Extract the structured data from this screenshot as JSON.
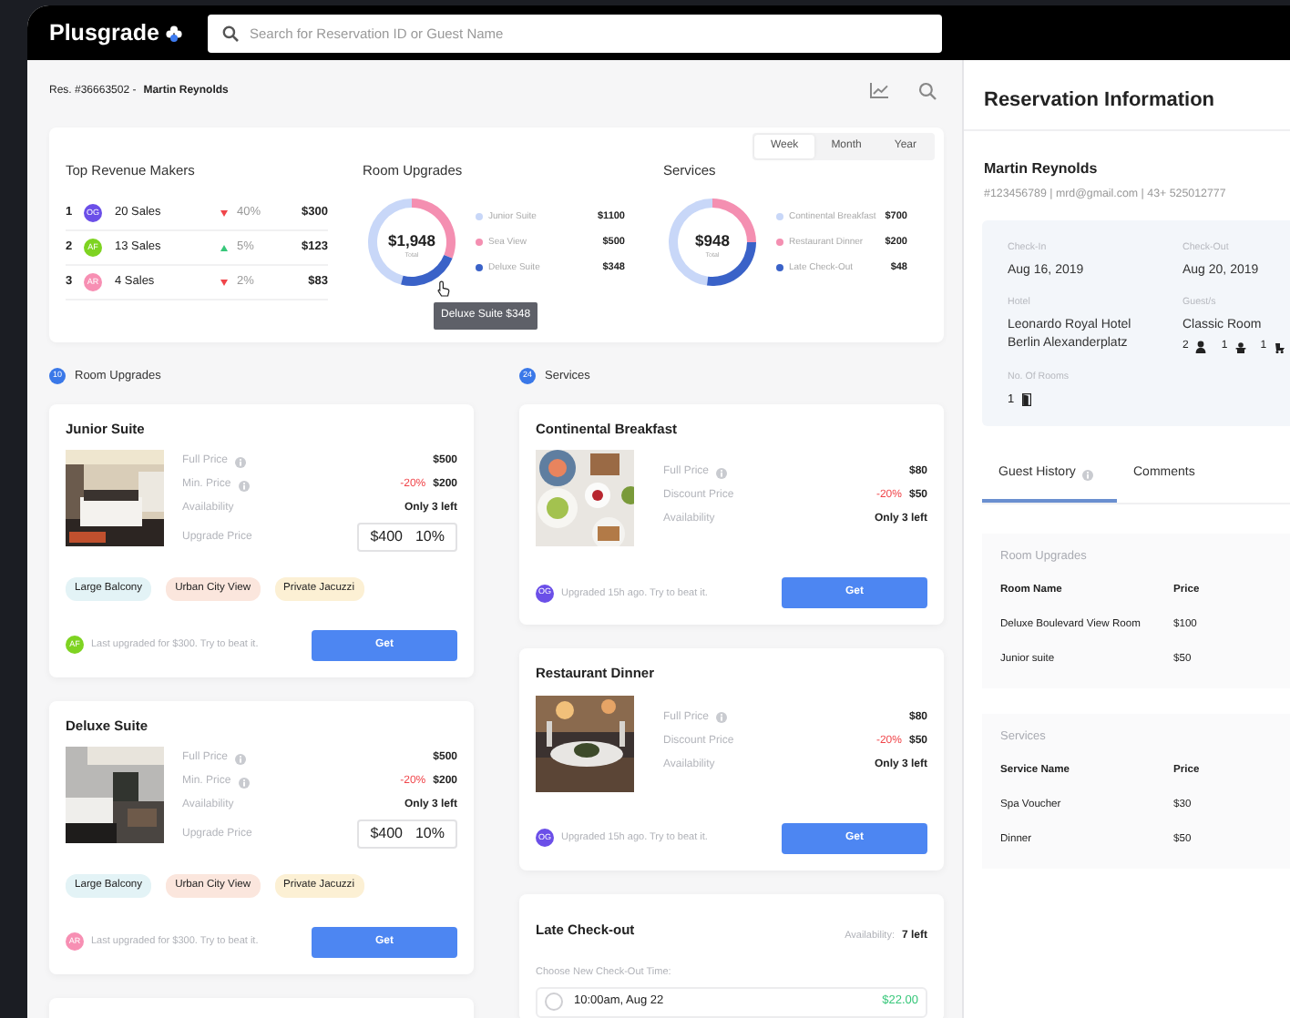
{
  "topbar": {
    "logo": "Plusgrade",
    "search_placeholder": "Search for Reservation ID or Guest Name"
  },
  "breadcrumb": {
    "reservation": "Res. #36663502 -",
    "guest": "Martin Reynolds"
  },
  "period_tabs": [
    {
      "label": "Week",
      "selected": true
    },
    {
      "label": "Month",
      "selected": false
    },
    {
      "label": "Year",
      "selected": false
    }
  ],
  "top_revenue": {
    "title": "Top Revenue Makers",
    "rows": [
      {
        "rank": "1",
        "initials": "OG",
        "color": "#6b4fe8",
        "sales": "20 Sales",
        "rising": false,
        "change": "40%",
        "amount": "$300"
      },
      {
        "rank": "2",
        "initials": "AF",
        "color": "#7ed321",
        "sales": "13 Sales",
        "rising": true,
        "change": "5%",
        "amount": "$123"
      },
      {
        "rank": "3",
        "initials": "AR",
        "color": "#f78fb3",
        "sales": "4 Sales",
        "rising": false,
        "change": "2%",
        "amount": "$83"
      }
    ]
  },
  "summaries": [
    {
      "title": "Room Upgrades",
      "total": "$1,948",
      "total_label": "Total",
      "tooltip": "Deluxe Suite $348",
      "legend": [
        {
          "value": "$1100",
          "color": "#c8d7f8"
        },
        {
          "value": "$500",
          "color": "#f48fb1"
        },
        {
          "value": "$348",
          "color": "#3a62c8"
        }
      ],
      "chart_data": {
        "type": "donut",
        "categories": [
          "Junior Suite",
          "Sea View",
          "Deluxe Suite"
        ],
        "values": [
          46,
          31,
          23
        ]
      }
    },
    {
      "title": "Services",
      "total": "$948",
      "total_label": "Total",
      "legend": [
        {
          "value": "$700",
          "color": "#c8d7f8"
        },
        {
          "value": "$200",
          "color": "#f48fb1"
        },
        {
          "value": "$48",
          "color": "#3a62c8"
        }
      ],
      "chart_data": {
        "type": "donut",
        "categories": [
          "Continental Breakfast",
          "Restaurant Dinner",
          "Late Check-Out"
        ],
        "values": [
          48,
          25,
          27
        ]
      }
    }
  ],
  "room_upgrades": {
    "count": "10",
    "title": "Room Upgrades",
    "cards": [
      {
        "title": "Junior Suite",
        "rows": [
          {
            "label": "Full Price",
            "info": true,
            "value": "$500"
          },
          {
            "label": "Min. Price",
            "info": true,
            "discount": "-20%",
            "value": "$200"
          },
          {
            "label": "Availability",
            "value": "Only 3 left"
          },
          {
            "label": "Upgrade Price",
            "kind": "field",
            "value": "$400",
            "percent": "10%"
          }
        ],
        "tags": [
          {
            "label": "Large Balcony",
            "color": "#e3f3f6"
          },
          {
            "label": "Urban City View",
            "color": "#fbe6dd"
          },
          {
            "label": "Private Jacuzzi",
            "color": "#fcf0d4"
          }
        ],
        "footer": {
          "initials": "AF",
          "color": "#7ed321",
          "note": "Last upgraded for $300. Try to beat it.",
          "button": "Get"
        }
      },
      {
        "title": "Deluxe Suite",
        "rows": [
          {
            "label": "Full Price",
            "info": true,
            "value": "$500"
          },
          {
            "label": "Min. Price",
            "info": true,
            "discount": "-20%",
            "value": "$200"
          },
          {
            "label": "Availability",
            "value": "Only 3 left"
          },
          {
            "label": "Upgrade Price",
            "kind": "field",
            "value": "$400",
            "percent": "10%"
          }
        ],
        "tags": [
          {
            "label": "Large Balcony",
            "color": "#e3f3f6"
          },
          {
            "label": "Urban City View",
            "color": "#fbe6dd"
          },
          {
            "label": "Private Jacuzzi",
            "color": "#fcf0d4"
          }
        ],
        "footer": {
          "initials": "AR",
          "color": "#f78fb3",
          "note": "Last upgraded for $300. Try to beat it.",
          "button": "Get"
        }
      }
    ]
  },
  "services": {
    "count": "24",
    "title": "Services",
    "cards": [
      {
        "title": "Continental Breakfast",
        "rows": [
          {
            "label": "Full Price",
            "info": true,
            "value": "$80"
          },
          {
            "label": "Discount Price",
            "discount": "-20%",
            "value": "$50"
          },
          {
            "label": "Availability",
            "value": "Only 3 left"
          }
        ],
        "footer": {
          "initials": "OG",
          "color": "#6b4fe8",
          "note": "Upgraded 15h ago. Try to beat it.",
          "button": "Get"
        }
      },
      {
        "title": "Restaurant Dinner",
        "rows": [
          {
            "label": "Full Price",
            "info": true,
            "value": "$80"
          },
          {
            "label": "Discount Price",
            "discount": "-20%",
            "value": "$50"
          },
          {
            "label": "Availability",
            "value": "Only 3 left"
          }
        ],
        "footer": {
          "initials": "OG",
          "color": "#6b4fe8",
          "note": "Upgraded 15h ago. Try to beat it.",
          "button": "Get"
        }
      }
    ],
    "late_checkout": {
      "title": "Late Check-out",
      "availability_label": "Availability:",
      "availability": "7 left",
      "prompt": "Choose New Check-Out Time:",
      "options": [
        {
          "label": "10:00am, Aug 22",
          "price": "$22.00",
          "selected": false
        }
      ]
    }
  },
  "reservation": {
    "title": "Reservation Information",
    "guest_name": "Martin Reynolds",
    "contact": "#123456789 | mrd@gmail.com | 43+ 525012777",
    "details": [
      {
        "label": "Check-In",
        "value_lines": [
          "Aug 16, 2019"
        ]
      },
      {
        "label": "Check-Out",
        "value_lines": [
          "Aug 20, 2019"
        ]
      },
      {
        "label": "Hotel",
        "value_lines": [
          "Leonardo Royal Hotel",
          "Berlin Alexanderplatz"
        ]
      },
      {
        "label": "Guest/s",
        "value_lines": [
          "Classic Room"
        ],
        "guests": [
          {
            "kind": "adult",
            "count": "2"
          },
          {
            "kind": "child",
            "count": "1"
          },
          {
            "kind": "infant",
            "count": "1"
          }
        ]
      },
      {
        "label": "No. Of Rooms",
        "rooms": "1"
      }
    ],
    "tabs": [
      {
        "label": "Guest History",
        "info": true,
        "selected": true
      },
      {
        "label": "Comments",
        "selected": false
      }
    ],
    "history": [
      {
        "title": "Room Upgrades",
        "columns": [
          "Room Name",
          "Price"
        ],
        "rows": [
          [
            "Deluxe Boulevard View Room",
            "$100"
          ],
          [
            "Junior suite",
            "$50"
          ]
        ]
      },
      {
        "title": "Services",
        "columns": [
          "Service Name",
          "Price"
        ],
        "rows": [
          [
            "Spa Voucher",
            "$30"
          ],
          [
            "Dinner",
            "$50"
          ]
        ]
      }
    ]
  }
}
